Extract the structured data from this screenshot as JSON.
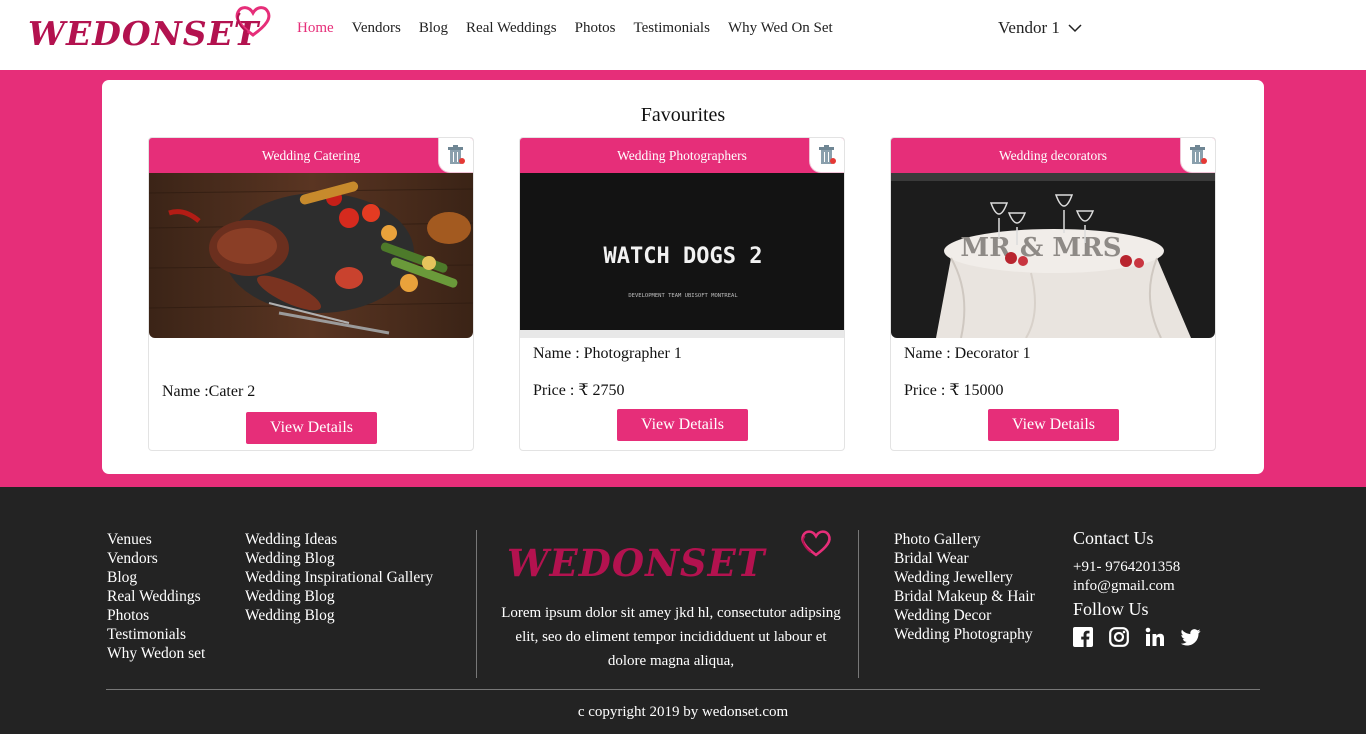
{
  "brand": {
    "logo_text": "WEDONSET",
    "accent": "#e62e79",
    "logo_color": "#b3124f"
  },
  "nav": {
    "items": [
      {
        "label": "Home",
        "active": true
      },
      {
        "label": "Vendors"
      },
      {
        "label": "Blog"
      },
      {
        "label": "Real Weddings"
      },
      {
        "label": "Photos"
      },
      {
        "label": "Testimonials"
      },
      {
        "label": "Why Wed On Set"
      }
    ],
    "user_menu": "Vendor 1"
  },
  "favourites": {
    "title": "Favourites",
    "cards": [
      {
        "category": "Wedding Catering",
        "name": "Name :Cater 2",
        "price": "",
        "button": "View Details",
        "image": "grilled-food-photo"
      },
      {
        "category": "Wedding Photographers",
        "name": "Name : Photographer 1",
        "price": "Price : ₹ 2750",
        "button": "View Details",
        "image": "title-screen-photo",
        "image_title": "WATCH DOGS 2",
        "image_caption": "DEVELOPMENT TEAM UBISOFT MONTREAL"
      },
      {
        "category": "Wedding decorators",
        "name": "Name : Decorator 1",
        "price": "Price : ₹ 15000",
        "button": "View Details",
        "image": "table-decor-photo",
        "image_title": "MR & MRS"
      }
    ]
  },
  "footer": {
    "col1": [
      "Venues",
      "Vendors",
      "Blog",
      "Real Weddings",
      "Photos",
      "Testimonials",
      "Why Wedon set"
    ],
    "col2": [
      "Wedding Ideas",
      "Wedding Blog",
      "Wedding Inspirational Gallery",
      "Wedding Blog",
      "Wedding Blog"
    ],
    "logo_text": "WEDONSET",
    "about": "Lorem ipsum dolor sit amey jkd hl, consectutor adipsing elit, seo do eliment tempor incididduent ut labour et dolore magna aliqua,",
    "col3": [
      "Photo Gallery",
      "Bridal Wear",
      "Wedding Jewellery",
      "Bridal Makeup & Hair",
      "Wedding Decor",
      "Wedding Photography"
    ],
    "contact_title": "Contact Us",
    "phone": "+91- 9764201358",
    "email": "info@gmail.com",
    "follow_title": "Follow Us",
    "socials": [
      "facebook-icon",
      "instagram-icon",
      "linkedin-icon",
      "twitter-icon"
    ],
    "copyright": "c copyright 2019 by wedonset.com"
  }
}
